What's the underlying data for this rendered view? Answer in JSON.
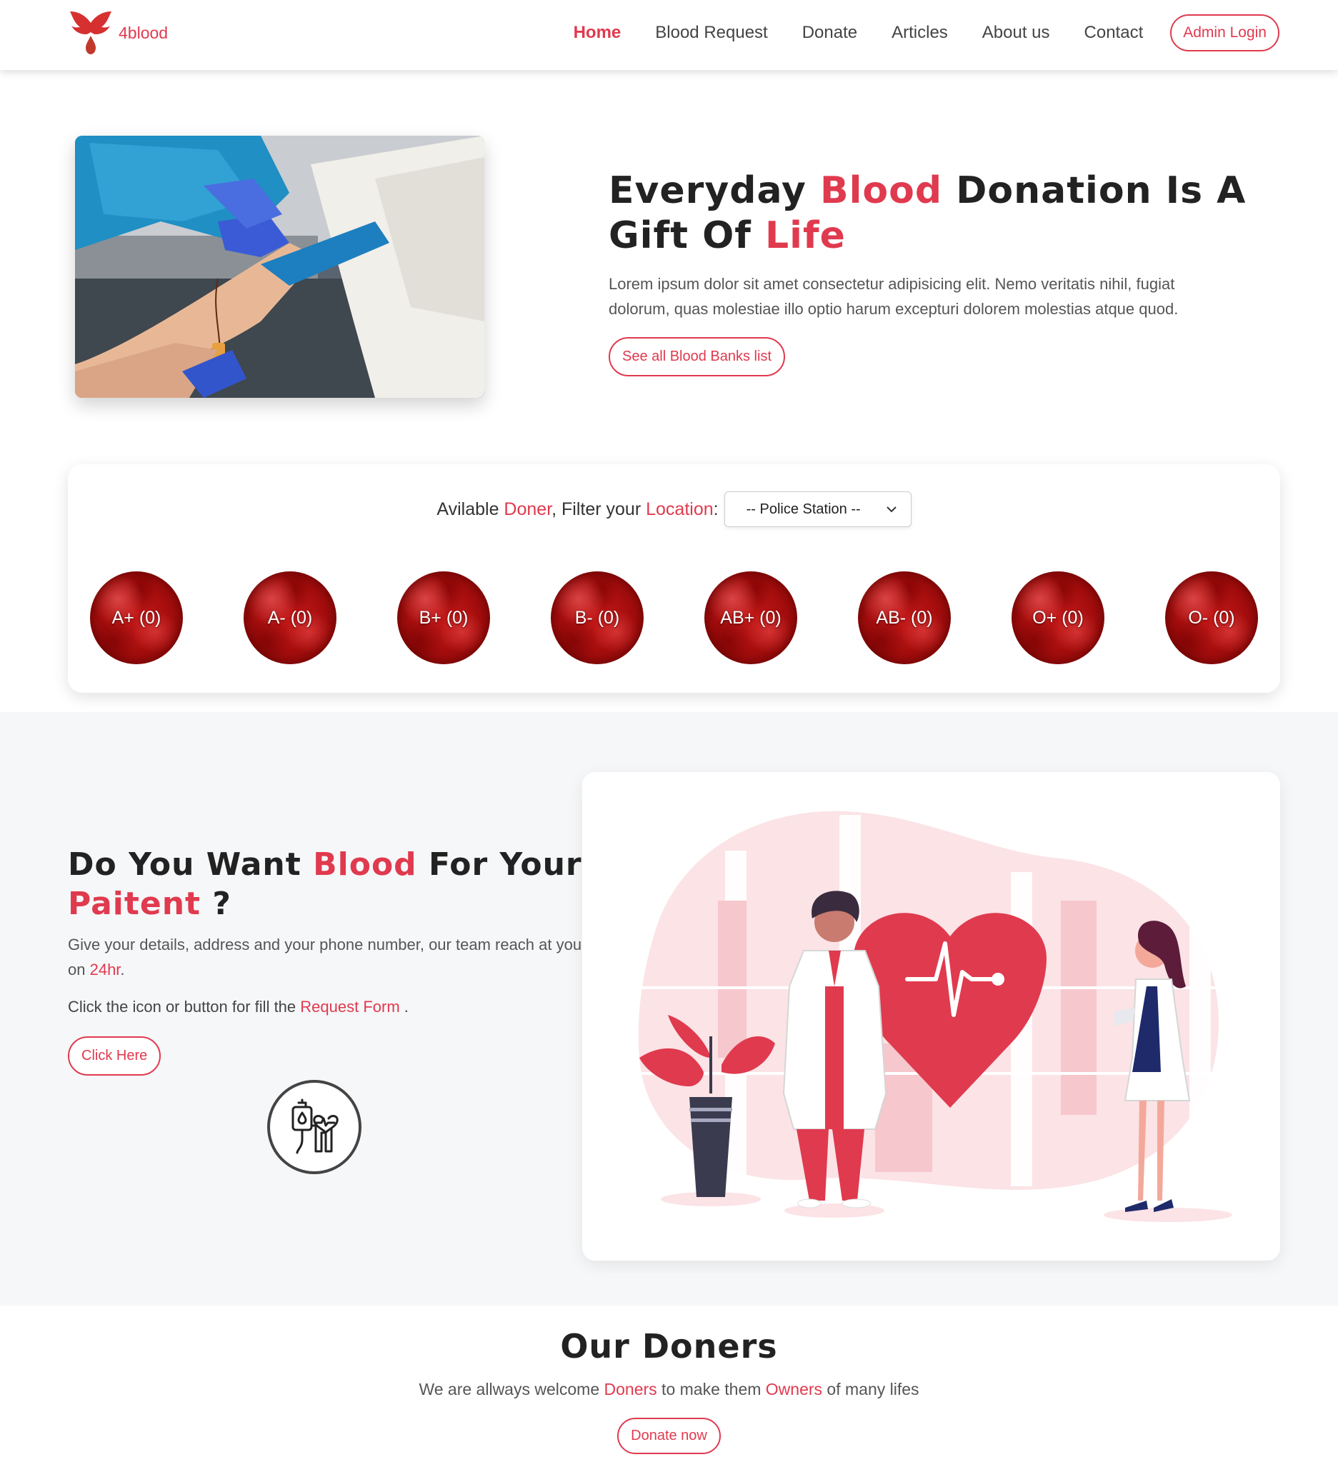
{
  "nav": {
    "brand": "4blood",
    "links": [
      "Home",
      "Blood Request",
      "Donate",
      "Articles",
      "About us",
      "Contact"
    ],
    "admin_login": "Admin Login"
  },
  "hero": {
    "title_1": "Everyday ",
    "title_red_1": "Blood",
    "title_2": " Donation Is A Gift Of ",
    "title_red_2": "Life",
    "description": "Lorem ipsum dolor sit amet consectetur adipisicing elit. Nemo veritatis nihil, fugiat dolorum, quas molestiae illo optio harum excepturi dolorem molestias atque quod.",
    "button": "See all Blood Banks list"
  },
  "filter": {
    "label_1": "Avilable ",
    "label_red_1": "Doner",
    "label_2": ", Filter your ",
    "label_red_2": "Location",
    "label_3": ":",
    "select_value": "-- Police Station --",
    "groups": [
      "A+ (0)",
      "A- (0)",
      "B+ (0)",
      "B- (0)",
      "AB+ (0)",
      "AB- (0)",
      "O+ (0)",
      "O- (0)"
    ]
  },
  "request": {
    "title_1": "Do You Want ",
    "title_red_1": "Blood",
    "title_2": " For Your ",
    "title_red_2": "Paitent",
    "title_3": " ?",
    "desc_1": "Give your details, address and your phone number, our team reach at you on ",
    "desc_red": "24hr",
    "desc_2": ".",
    "click_1": "Click the icon or button for fill the ",
    "click_red": "Request Form",
    "click_2": " .",
    "button": "Click Here"
  },
  "doners": {
    "title": "Our Doners",
    "desc_1": "We are allways welcome ",
    "desc_red_1": "Doners",
    "desc_2": " to make them ",
    "desc_red_2": "Owners",
    "desc_3": " of many lifes",
    "button": "Donate now"
  },
  "colors": {
    "accent": "#e03a4e",
    "section_bg": "#f6f7f9"
  }
}
